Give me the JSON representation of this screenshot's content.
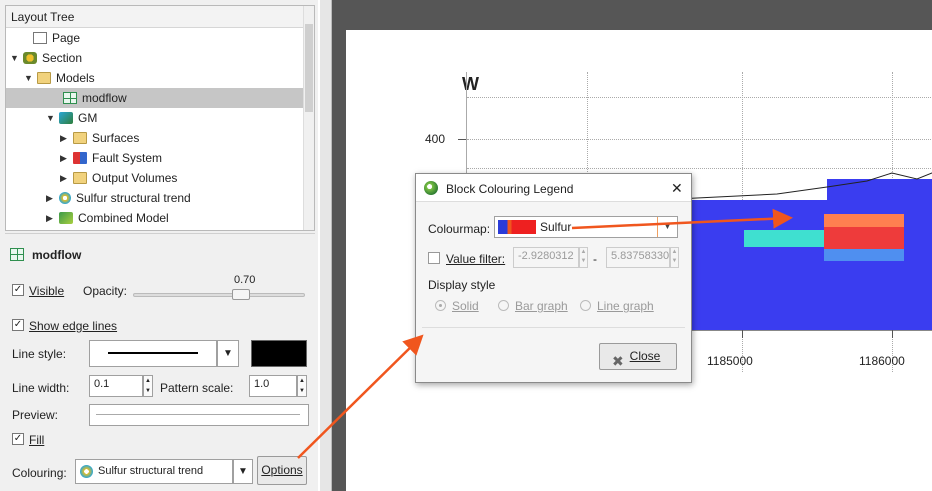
{
  "tree": {
    "header": "Layout Tree",
    "items": [
      {
        "label": "Page",
        "arrow": ""
      },
      {
        "label": "Section",
        "arrow": "▼"
      },
      {
        "label": "Models",
        "arrow": "▼"
      },
      {
        "label": "modflow",
        "arrow": ""
      },
      {
        "label": "GM",
        "arrow": "▼"
      },
      {
        "label": "Surfaces",
        "arrow": "▶"
      },
      {
        "label": "Fault System",
        "arrow": "▶"
      },
      {
        "label": "Output Volumes",
        "arrow": "▶"
      },
      {
        "label": "Sulfur structural trend",
        "arrow": "▶"
      },
      {
        "label": "Combined Model",
        "arrow": "▶"
      }
    ]
  },
  "props": {
    "title": "modflow",
    "visible_label": "Visible",
    "visible_checked": "✓",
    "opacity_label": "Opacity:",
    "opacity_value": "0.70",
    "show_edge_label": "Show edge lines",
    "show_edge_checked": "✓",
    "line_style_label": "Line style:",
    "line_width_label": "Line width:",
    "line_width_value": "0.1",
    "pattern_scale_label": "Pattern scale:",
    "pattern_scale_value": "1.0",
    "preview_label": "Preview:",
    "fill_label": "Fill",
    "fill_checked": "✓",
    "colouring_label": "Colouring:",
    "colouring_value": "Sulfur structural trend",
    "options_label": "Options",
    "line_color": "#000000"
  },
  "view": {
    "section_label": "W",
    "y_tick": "400",
    "x_ticks": [
      "1185000",
      "1186000"
    ]
  },
  "dialog": {
    "title": "Block Colouring Legend",
    "close_x": "✕",
    "colourmap_label": "Colourmap:",
    "colourmap_value": "Sulfur",
    "value_filter_label": "Value filter:",
    "filter_min": "-2.9280312",
    "filter_sep": "-",
    "filter_max": "5.83758330",
    "display_style_label": "Display style",
    "styles": [
      "Solid",
      "Bar graph",
      "Line graph"
    ],
    "close_button": "Close"
  },
  "colors": {
    "accent_arrow": "#f0561e",
    "model_blue": "#3a3df0",
    "orange": "#ff7f50",
    "red": "#ee3b3b",
    "cyan": "#3fe0d0",
    "light_blue": "#4f8ff0"
  }
}
